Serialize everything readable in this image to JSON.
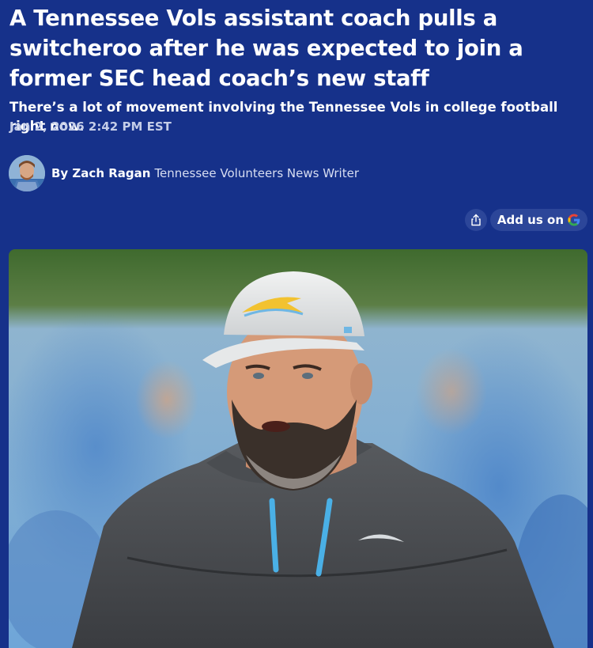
{
  "article": {
    "headline": "A Tennessee Vols assistant coach pulls a switcheroo after he was expected to join a former SEC head coach’s new staff",
    "dek": "There’s a lot of movement involving the Tennessee Vols in college football right now.",
    "timestamp": "Jan 2, 2026 2:42 PM EST",
    "author": {
      "by": "By Zach Ragan",
      "role": "Tennessee Volunteers News Writer"
    }
  },
  "actions": {
    "share_icon": "share-icon",
    "add_us_label": "Add us on",
    "google_icon": "google-icon"
  },
  "hero_image": {
    "subject": "coach-photo"
  },
  "colors": {
    "background": "#16318a",
    "button_bg": "#2c4699",
    "text": "#ffffff",
    "muted_text": "#c4cde8"
  }
}
